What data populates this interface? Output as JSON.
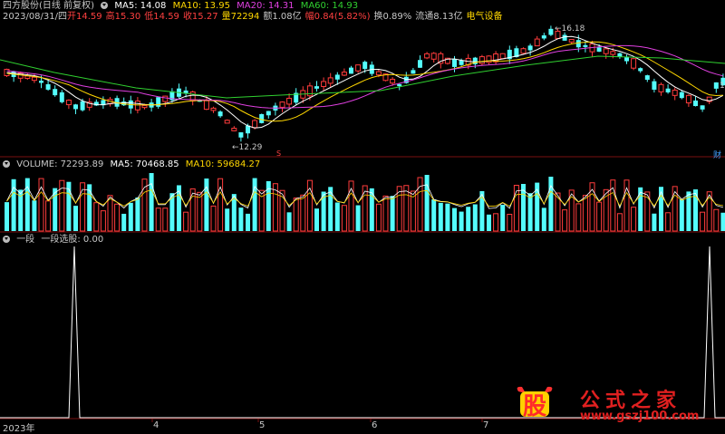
{
  "header": {
    "title": "四方股份(日线 前复权)",
    "ma": [
      {
        "label": "MA5: 14.08",
        "color": "#ffffff"
      },
      {
        "label": "MA10: 13.95",
        "color": "#ffd700"
      },
      {
        "label": "MA20: 14.31",
        "color": "#e040e0"
      },
      {
        "label": "MA60: 14.93",
        "color": "#30d030"
      }
    ]
  },
  "quote": {
    "date": "2023/08/31/四",
    "open": "开14.59",
    "high": "高15.30",
    "low": "低14.59",
    "close": "收15.27",
    "volume": "量72294",
    "amount": "额1.08亿",
    "change": "幅0.84(5.82%)",
    "turnover": "换0.89%",
    "float": "流通8.13亿",
    "sector": "电气设备"
  },
  "price_panel": {
    "high_label": "16.18",
    "low_label": "12.29",
    "right_label": "14",
    "mark_s": "S",
    "mark_cai": "财"
  },
  "volume_panel": {
    "title": "VOLUME: 72293.89",
    "ma5": "MA5: 70468.85",
    "ma10": "MA10: 59684.27",
    "colors": {
      "ma5": "#ffffff",
      "ma10": "#ffd700"
    }
  },
  "indicator_panel": {
    "name": "一段",
    "value": "一段选股: 0.00"
  },
  "x_axis": {
    "labels": [
      "2023年",
      "4",
      "5",
      "6",
      "7"
    ]
  },
  "watermark": {
    "logo": "股",
    "title": "公式之家",
    "url": "www.gszj100.com"
  }
}
